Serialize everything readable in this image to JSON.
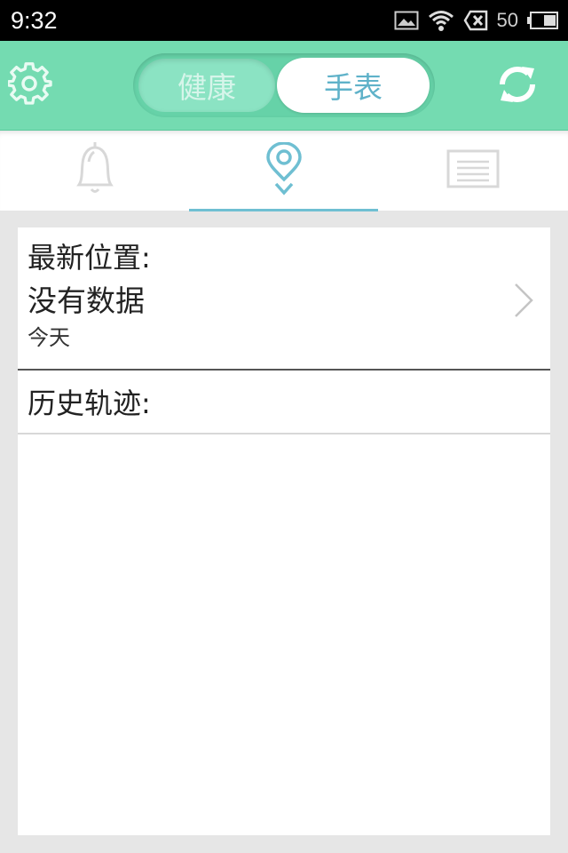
{
  "status_bar": {
    "time": "9:32",
    "battery_level": "50",
    "icons": [
      "image-icon",
      "wifi-icon",
      "no-sim-icon",
      "battery-icon"
    ]
  },
  "header": {
    "segments": [
      {
        "label": "健康",
        "selected": false
      },
      {
        "label": "手表",
        "selected": true
      }
    ],
    "left_icon": "gear-icon",
    "right_icon": "refresh-icon",
    "colors": {
      "header_bg": "#74dbb1",
      "selected_text": "#5fb2c9",
      "accent": "#6fbfd2"
    }
  },
  "tabs": [
    {
      "icon": "bell-icon",
      "active": false
    },
    {
      "icon": "location-pin-icon",
      "active": true
    },
    {
      "icon": "list-icon",
      "active": false
    }
  ],
  "location": {
    "latest_title": "最新位置:",
    "latest_value": "没有数据",
    "latest_date": "今天",
    "history_title": "历史轨迹:"
  }
}
